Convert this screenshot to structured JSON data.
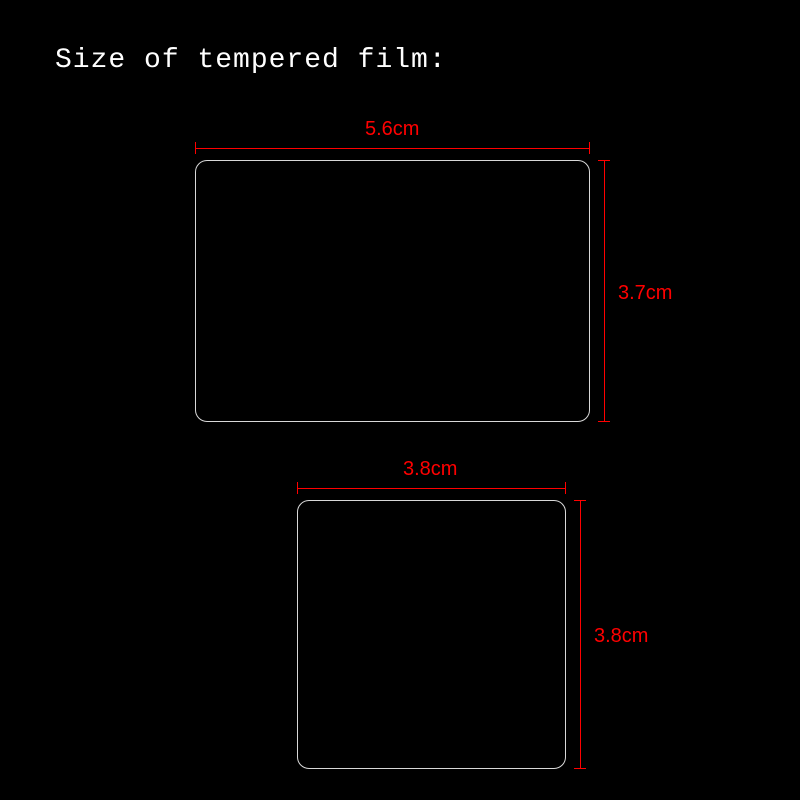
{
  "title": "Size of tempered film:",
  "rect1": {
    "width_label": "5.6cm",
    "height_label": "3.7cm"
  },
  "rect2": {
    "width_label": "3.8cm",
    "height_label": "3.8cm"
  }
}
